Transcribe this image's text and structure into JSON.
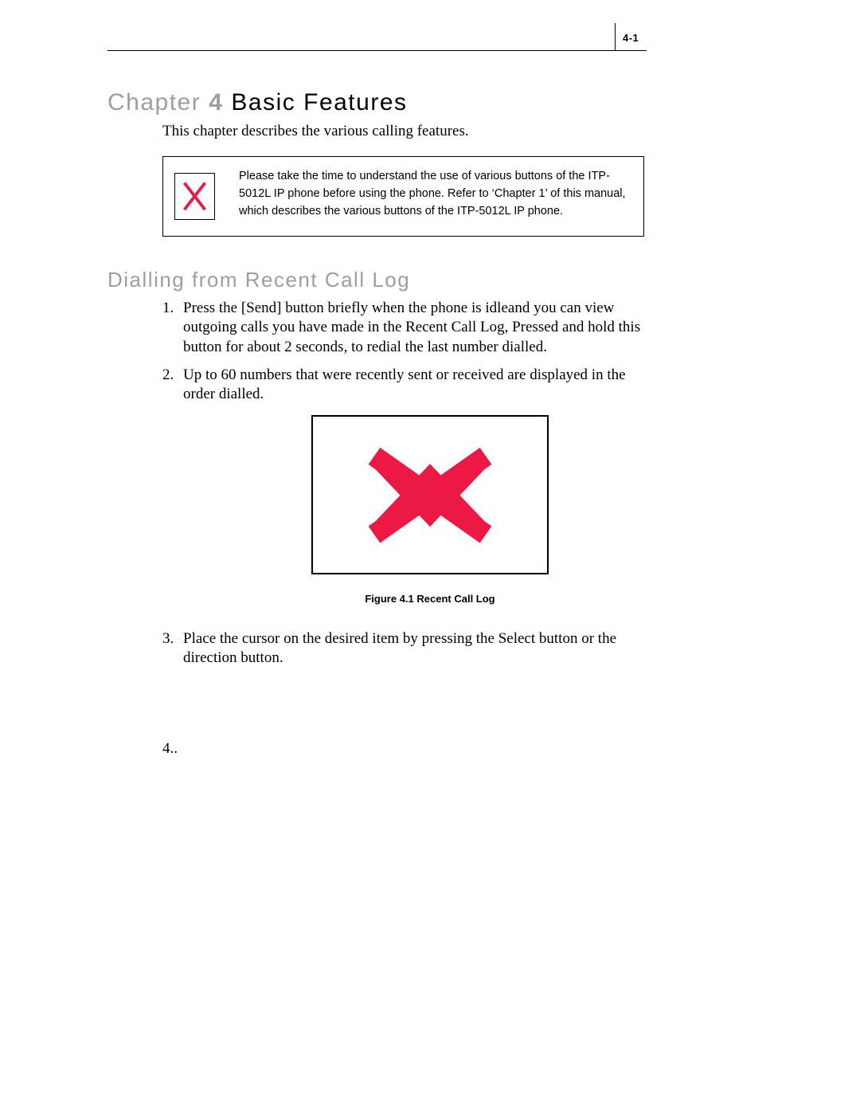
{
  "header": {
    "page_number": "4-1"
  },
  "chapter": {
    "prefix": "Chapter",
    "number": "4",
    "title": "Basic Features",
    "intro": "This chapter describes the various calling features."
  },
  "note": {
    "text": "Please take the time to understand the use of various buttons of the ITP-5012L IP phone before using the phone. Refer to ‘Chapter 1’ of this manual, which describes the various buttons of the ITP-5012L IP phone."
  },
  "section": {
    "title": "Dialling from Recent Call Log"
  },
  "items": {
    "i1": {
      "marker": "1.",
      "text": "Press the [Send] button briefly when the phone is idleand you can view outgoing calls you have made in the Recent Call Log, Pressed and hold this button for about 2 seconds, to redial the last number dialled."
    },
    "i2": {
      "marker": "2.",
      "text": "Up to 60 numbers that were recently sent or received are displayed in the order dialled."
    },
    "i3": {
      "marker": "3.",
      "text": "Place the cursor on the desired item by pressing the Select button or the direction button."
    },
    "i4": {
      "marker": "4..",
      "text": ""
    }
  },
  "figure": {
    "caption": "Figure 4.1   Recent Call Log"
  }
}
